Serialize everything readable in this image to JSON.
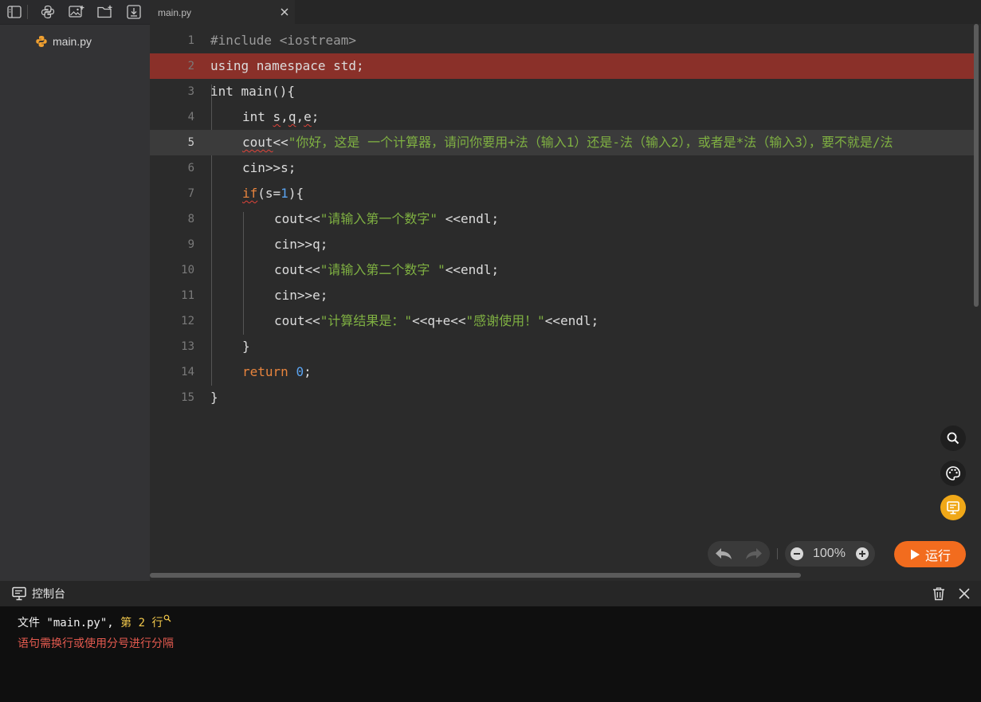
{
  "sidebar": {
    "toolbar": [
      {
        "icon": "sidebar-toggle-icon"
      },
      {
        "icon": "python-icon"
      },
      {
        "icon": "image-add-icon"
      },
      {
        "icon": "folder-add-icon"
      },
      {
        "icon": "download-icon"
      }
    ],
    "files": [
      {
        "name": "main.py",
        "icon": "python-icon"
      }
    ]
  },
  "tabs": [
    {
      "label": "main.py",
      "close": "×"
    }
  ],
  "editor": {
    "error_line": 2,
    "current_line": 5,
    "lines": [
      {
        "n": "1"
      },
      {
        "n": "2"
      },
      {
        "n": "3"
      },
      {
        "n": "4"
      },
      {
        "n": "5"
      },
      {
        "n": "6"
      },
      {
        "n": "7"
      },
      {
        "n": "8"
      },
      {
        "n": "9"
      },
      {
        "n": "10"
      },
      {
        "n": "11"
      },
      {
        "n": "12"
      },
      {
        "n": "13"
      },
      {
        "n": "14"
      },
      {
        "n": "15"
      }
    ],
    "code": {
      "l1": "#include <iostream>",
      "l2": "using namespace std;",
      "l3_a": "int ",
      "l3_b": "main",
      "l3_c": "(){",
      "l4_a": "int ",
      "l4_b": "s",
      "l4_c": ",",
      "l4_d": "q",
      "l4_e": ",",
      "l4_f": "e",
      "l4_g": ";",
      "l5_a": "cout",
      "l5_b": "<<",
      "l5_c": "\"你好，这是 一个计算器，请问你要用+法（输入1）还是-法（输入2），或者是*法（输入3），要不就是/法",
      "l6": "cin>>s;",
      "l7_a": "if",
      "l7_b": "(s=",
      "l7_c": "1",
      "l7_d": "){",
      "l8_a": "cout<<",
      "l8_b": "\"请输入第一个数字\"",
      "l8_c": " <<endl;",
      "l9": "cin>>q;",
      "l10_a": "cout<<",
      "l10_b": "\"请输入第二个数字 \"",
      "l10_c": "<<endl;",
      "l11": "cin>>e;",
      "l12_a": "cout<<",
      "l12_b": "\"计算结果是：\"",
      "l12_c": "<<q+e<<",
      "l12_d": "\"感谢使用！\"",
      "l12_e": "<<endl;",
      "l13": "}",
      "l14_a": "return ",
      "l14_b": "0",
      "l14_c": ";",
      "l15": "}"
    }
  },
  "controls": {
    "zoom": "100%",
    "run_label": "运行",
    "fab_icons": [
      "search-icon",
      "palette-icon",
      "presentation-icon"
    ]
  },
  "console": {
    "title": "控制台",
    "line1_a": "文件 \"main.py\", ",
    "line1_b": "第 2 行",
    "line2": "语句需换行或使用分号进行分隔"
  },
  "colors": {
    "error_bg": "#8a3029",
    "accent": "#f26c1e",
    "string": "#7fb042",
    "keyword": "#e8843d",
    "number": "#5aa3f0"
  }
}
